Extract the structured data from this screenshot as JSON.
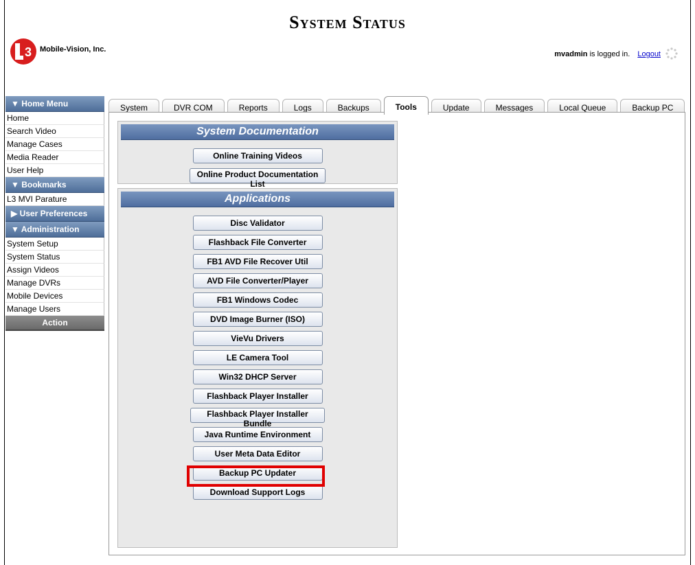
{
  "header": {
    "title": "System Status",
    "company": "Mobile-Vision, Inc.",
    "username": "mvadmin",
    "logged_in_text": "is logged in.",
    "logout_label": "Logout"
  },
  "sidebar": {
    "home_menu": {
      "label": "▼ Home Menu",
      "items": [
        "Home",
        "Search Video",
        "Manage Cases",
        "Media Reader",
        "User Help"
      ]
    },
    "bookmarks": {
      "label": "▼ Bookmarks",
      "items": [
        "L3 MVI Parature"
      ]
    },
    "user_preferences": {
      "label": "▶ User Preferences"
    },
    "administration": {
      "label": "▼ Administration",
      "items": [
        "System Setup",
        "System Status",
        "Assign Videos",
        "Manage DVRs",
        "Mobile Devices",
        "Manage Users"
      ]
    },
    "action_label": "Action"
  },
  "tabs": [
    "System",
    "DVR COM",
    "Reports",
    "Logs",
    "Backups",
    "Tools",
    "Update",
    "Messages",
    "Local Queue",
    "Backup PC"
  ],
  "active_tab": "Tools",
  "documentation": {
    "heading": "System Documentation",
    "buttons": [
      "Online Training Videos",
      "Online Product Documentation List"
    ]
  },
  "applications": {
    "heading": "Applications",
    "buttons": [
      "Disc Validator",
      "Flashback File Converter",
      "FB1 AVD File Recover Util",
      "AVD File Converter/Player",
      "FB1 Windows Codec",
      "DVD Image Burner (ISO)",
      "VieVu Drivers",
      "LE Camera Tool",
      "Win32 DHCP Server",
      "Flashback Player Installer",
      "Flashback Player Installer Bundle",
      "Java Runtime Environment",
      "User Meta Data Editor",
      "Backup PC Updater",
      "Download Support Logs"
    ],
    "highlighted_button": "Backup PC Updater"
  },
  "colors": {
    "sidebar_header": "#5a78a3",
    "section_header": "#6282b4",
    "highlight": "#e00000",
    "link": "#0000cc"
  }
}
